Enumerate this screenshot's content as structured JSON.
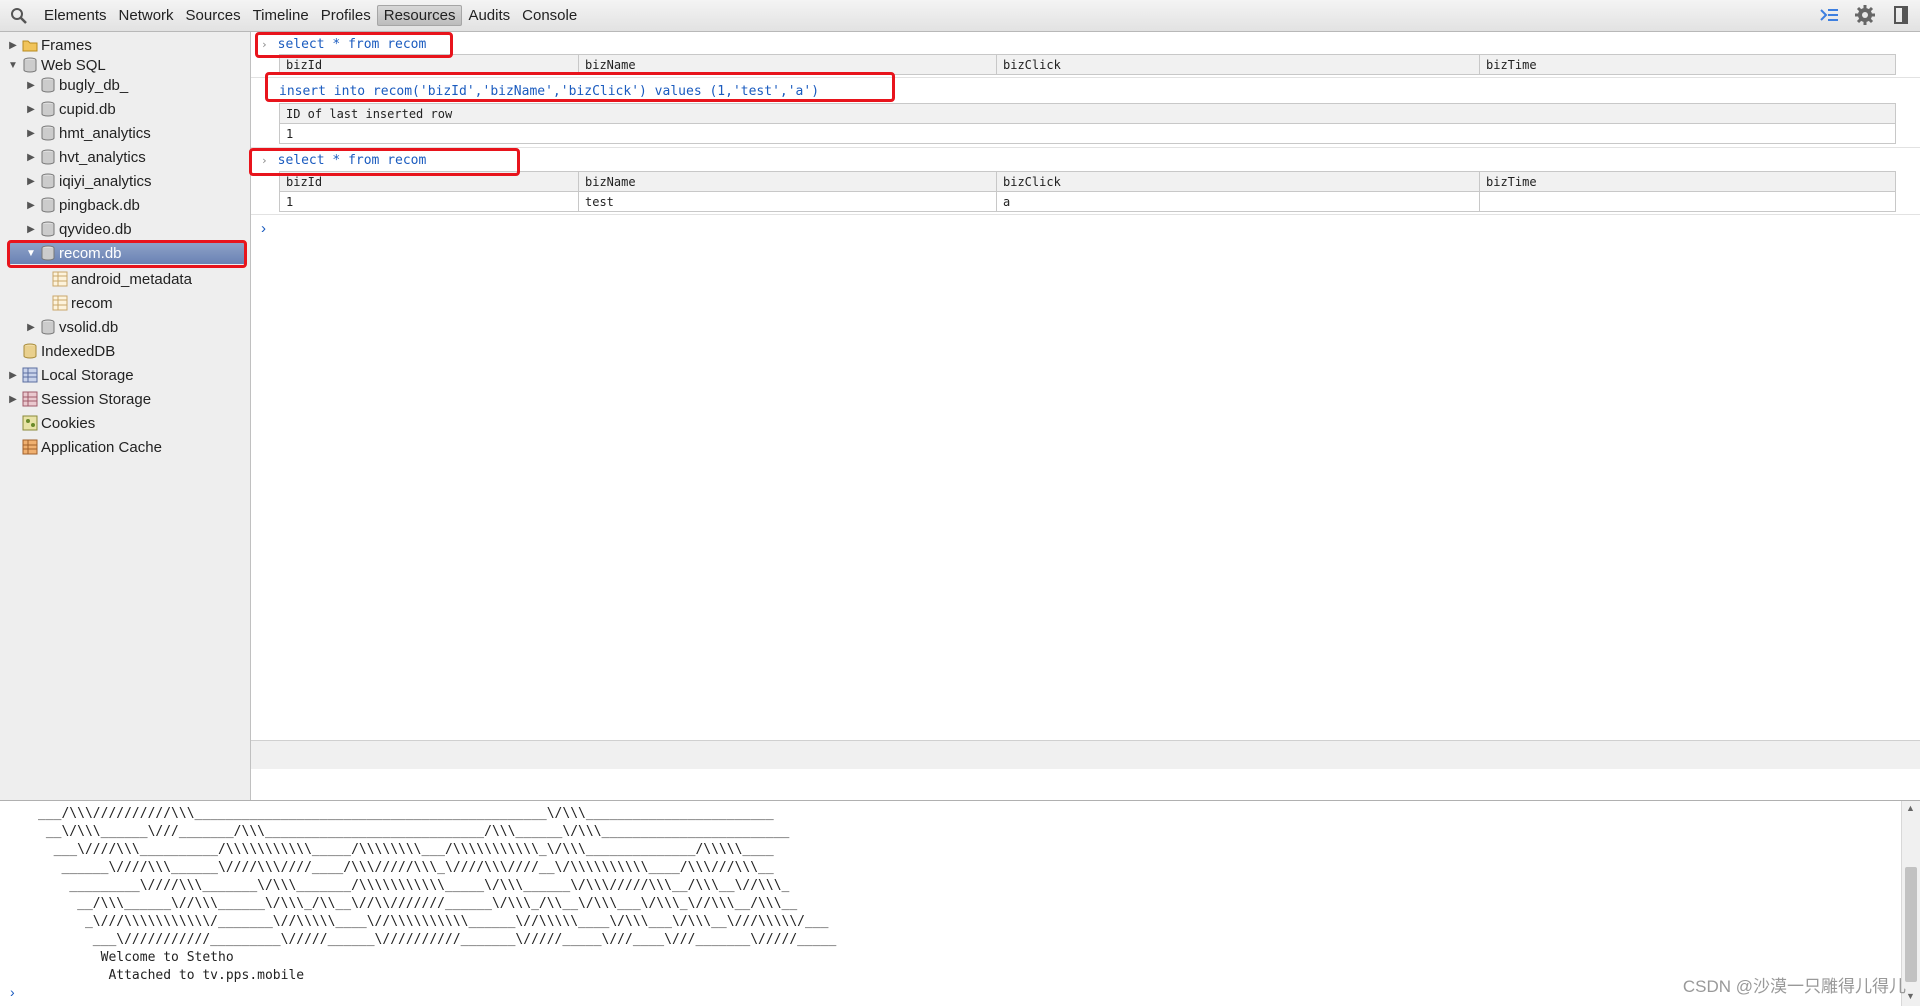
{
  "toolbar": {
    "tabs": [
      "Elements",
      "Network",
      "Sources",
      "Timeline",
      "Profiles",
      "Resources",
      "Audits",
      "Console"
    ],
    "selected_tab": "Resources"
  },
  "sidebar": {
    "frames": "Frames",
    "websql": "Web SQL",
    "dbs": [
      "bugly_db_",
      "cupid.db",
      "hmt_analytics",
      "hvt_analytics",
      "iqiyi_analytics",
      "pingback.db",
      "qyvideo.db",
      "recom.db"
    ],
    "tables": [
      "android_metadata",
      "recom"
    ],
    "vsolid": "vsolid.db",
    "indexeddb": "IndexedDB",
    "local_storage": "Local Storage",
    "session_storage": "Session Storage",
    "cookies": "Cookies",
    "app_cache": "Application Cache"
  },
  "sql": {
    "query1": "select * from recom",
    "columns": [
      "bizId",
      "bizName",
      "bizClick",
      "bizTime"
    ],
    "query2": "insert into recom('bizId','bizName','bizClick') values (1,'test','a')",
    "insert_header": "ID of last inserted row",
    "insert_value": "1",
    "query3": "select * from recom",
    "row": [
      "1",
      "test",
      "a",
      ""
    ]
  },
  "console": {
    "ascii_art": "___/\\\\\\//////////\\\\\\_____________________________________________\\/\\\\\\________________________\n __\\/\\\\\\______\\///_______/\\\\\\____________________________/\\\\\\______\\/\\\\\\________________________\n  ___\\////\\\\\\__________/\\\\\\\\\\\\\\\\\\\\\\_____/\\\\\\\\\\\\\\\\___/\\\\\\\\\\\\\\\\\\\\\\_\\/\\\\\\______________/\\\\\\\\\\____\n   ______\\////\\\\\\______\\////\\\\\\////____/\\\\\\/////\\\\\\_\\////\\\\\\////__\\/\\\\\\\\\\\\\\\\\\\\____/\\\\\\///\\\\\\__\n    _________\\////\\\\\\_______\\/\\\\\\_______/\\\\\\\\\\\\\\\\\\\\\\_____\\/\\\\\\______\\/\\\\\\/////\\\\\\__/\\\\\\__\\//\\\\\\_\n     __/\\\\\\______\\//\\\\\\______\\/\\\\\\_/\\\\__\\//\\\\///////______\\/\\\\\\_/\\\\__\\/\\\\\\___\\/\\\\\\_\\//\\\\\\__/\\\\\\__\n      _\\///\\\\\\\\\\\\\\\\\\\\\\/_______\\//\\\\\\\\\\____\\//\\\\\\\\\\\\\\\\\\\\______\\//\\\\\\\\\\____\\/\\\\\\___\\/\\\\\\__\\///\\\\\\\\\\/___\n       ___\\///////////_________\\/////______\\//////////_______\\/////_____\\///____\\///_______\\/////_____\n        Welcome to Stetho\n         Attached to tv.pps.mobile"
  },
  "watermark": "CSDN @沙漠一只雕得儿得儿",
  "colors": {
    "highlight_box": "#e8141c",
    "selected_row": "#6a82b4",
    "sql_text": "#1a5bbf"
  }
}
